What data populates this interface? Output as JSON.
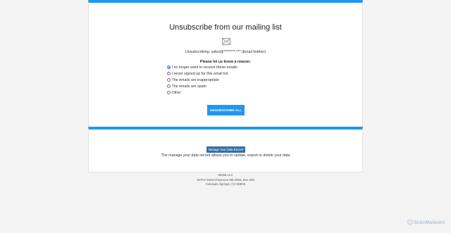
{
  "main": {
    "title": "Unsubscribe from our mailing list",
    "unsubscribing_line": "Unsubscribing: sales@********.*** (Email hidden)",
    "reason_heading": "Please let us know a reason:",
    "reasons": [
      {
        "label": "I no longer want to receive these emails",
        "selected": true
      },
      {
        "label": "I never signed up for this email list",
        "selected": false
      },
      {
        "label": "The emails are inappropriate",
        "selected": false
      },
      {
        "label": "The emails are spam",
        "selected": false
      },
      {
        "label": "Other",
        "selected": false
      }
    ],
    "unsubscribe_button": "UNSUBSCRIBE ALL"
  },
  "manage": {
    "button_label": "Manage Your Data Record",
    "description": "The manage your data record allows you to update, export or delete your data"
  },
  "footer": {
    "company": "Media LLC",
    "address_line1": "1670-F East Cheyenne Mtn Blvd, Box 293",
    "address_line2": "Colorado Springs, CO 80906"
  },
  "watermark": {
    "text": "ScanMalware"
  },
  "colors": {
    "accent": "#2196f3",
    "manage_button": "#3570a8",
    "background": "#f4f4f4"
  },
  "icons": {
    "mail": "envelope-icon",
    "watermark": "shield-logo-icon"
  }
}
